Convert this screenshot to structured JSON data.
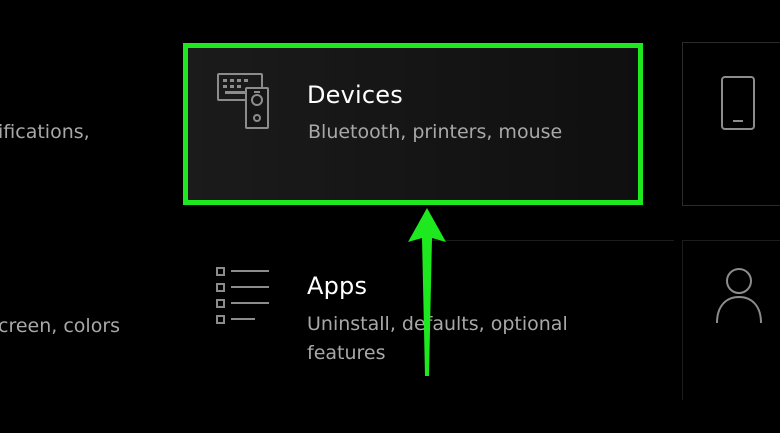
{
  "left_column": {
    "item_1_sub": "ifications,",
    "item_2_sub": "creen, colors"
  },
  "devices": {
    "title": "Devices",
    "subtitle": "Bluetooth, printers, mouse",
    "icon": "devices-icon",
    "highlight_color": "#1ee81e"
  },
  "apps": {
    "title": "Apps",
    "subtitle": "Uninstall, defaults, optional features",
    "icon": "apps-list-icon"
  },
  "right_column": {
    "item_1_icon": "phone-icon",
    "item_2_icon": "person-icon"
  },
  "annotation": {
    "arrow_color": "#1ee81e",
    "arrow_icon": "up-arrow-icon"
  }
}
